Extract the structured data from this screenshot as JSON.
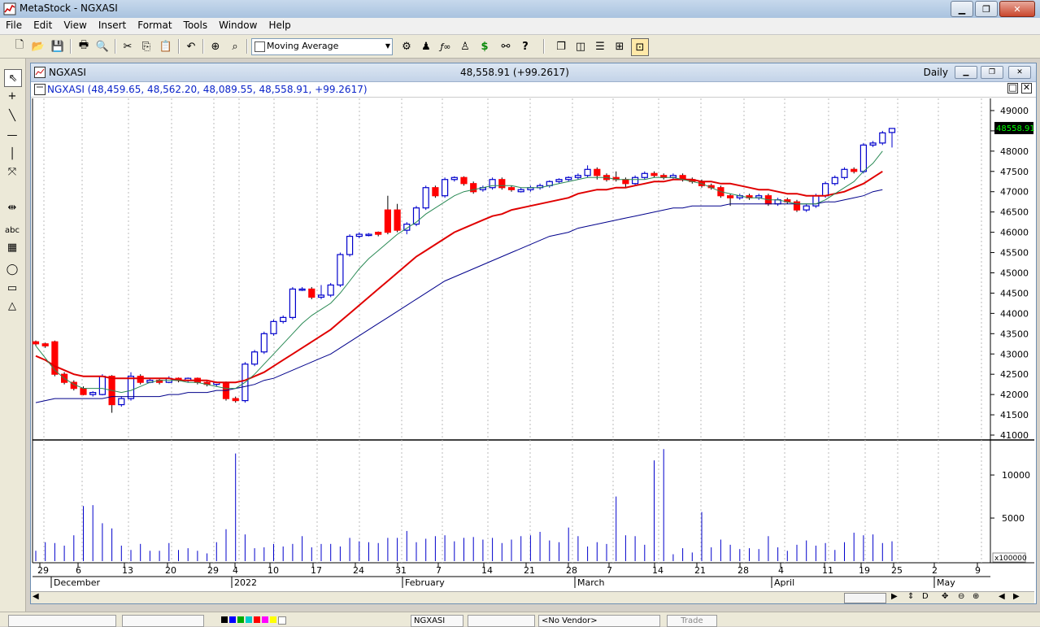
{
  "window": {
    "title": "MetaStock - NGXASI"
  },
  "menu": [
    "File",
    "Edit",
    "View",
    "Insert",
    "Format",
    "Tools",
    "Window",
    "Help"
  ],
  "toolbar": {
    "indicator_select": "Moving Average",
    "dollar": "$"
  },
  "chart_window": {
    "title": "NGXASI",
    "last_price": "48,558.91 (+99.2617)",
    "periodicity": "Daily",
    "security_info": "NGXASI (48,459.65, 48,562.20, 48,089.55, 48,558.91, +99.2617)",
    "price_tag": "48558.91",
    "volume_multiplier": "x100000"
  },
  "left_tools": {
    "abc_label": "abc"
  },
  "status": {
    "symbol": "NGXASI",
    "vendor": "<No Vendor>",
    "trade": "Trade"
  },
  "chart_data": {
    "type": "candlestick",
    "y_ticks": [
      "49000",
      "48500",
      "48000",
      "47500",
      "47000",
      "46500",
      "46000",
      "45500",
      "45000",
      "44500",
      "44000",
      "43500",
      "43000",
      "42500",
      "42000",
      "41500",
      "41000"
    ],
    "ylim": [
      40900,
      49300
    ],
    "volume_ticks": [
      "10000",
      "5000"
    ],
    "x_day_ticks": [
      "29",
      "6",
      "13",
      "20",
      "29",
      "4",
      "10",
      "17",
      "24",
      "31",
      "7",
      "14",
      "21",
      "28",
      "7",
      "14",
      "21",
      "28",
      "4",
      "11",
      "19",
      "25",
      "2",
      "9"
    ],
    "x_month_labels": [
      "December",
      "2022",
      "February",
      "March",
      "April",
      "May"
    ],
    "candles": [
      {
        "o": 43300,
        "c": 43250,
        "h": 43330,
        "l": 43200
      },
      {
        "o": 43250,
        "c": 43200,
        "h": 43280,
        "l": 43150
      },
      {
        "o": 43300,
        "c": 42500,
        "h": 43330,
        "l": 42450
      },
      {
        "o": 42500,
        "c": 42300,
        "h": 42550,
        "l": 42250
      },
      {
        "o": 42300,
        "c": 42150,
        "h": 42350,
        "l": 42100
      },
      {
        "o": 42150,
        "c": 42000,
        "h": 42200,
        "l": 41980
      },
      {
        "o": 42000,
        "c": 42050,
        "h": 42080,
        "l": 41950
      },
      {
        "o": 42000,
        "c": 42450,
        "h": 42500,
        "l": 41980
      },
      {
        "o": 42450,
        "c": 41750,
        "h": 42480,
        "l": 41550
      },
      {
        "o": 41750,
        "c": 41900,
        "h": 41950,
        "l": 41700
      },
      {
        "o": 41900,
        "c": 42450,
        "h": 42550,
        "l": 41850
      },
      {
        "o": 42450,
        "c": 42300,
        "h": 42500,
        "l": 42250
      },
      {
        "o": 42300,
        "c": 42350,
        "h": 42400,
        "l": 42280
      },
      {
        "o": 42350,
        "c": 42300,
        "h": 42400,
        "l": 42250
      },
      {
        "o": 42300,
        "c": 42400,
        "h": 42450,
        "l": 42280
      },
      {
        "o": 42400,
        "c": 42350,
        "h": 42420,
        "l": 42300
      },
      {
        "o": 42350,
        "c": 42400,
        "h": 42420,
        "l": 42300
      },
      {
        "o": 42400,
        "c": 42300,
        "h": 42420,
        "l": 42250
      },
      {
        "o": 42300,
        "c": 42250,
        "h": 42350,
        "l": 42200
      },
      {
        "o": 42250,
        "c": 42300,
        "h": 42320,
        "l": 42200
      },
      {
        "o": 42300,
        "c": 41900,
        "h": 42320,
        "l": 41850
      },
      {
        "o": 41900,
        "c": 41850,
        "h": 41950,
        "l": 41800
      },
      {
        "o": 41850,
        "c": 42750,
        "h": 42800,
        "l": 41800
      },
      {
        "o": 42750,
        "c": 43050,
        "h": 43100,
        "l": 42700
      },
      {
        "o": 43050,
        "c": 43500,
        "h": 43550,
        "l": 43000
      },
      {
        "o": 43500,
        "c": 43800,
        "h": 43850,
        "l": 43450
      },
      {
        "o": 43800,
        "c": 43900,
        "h": 43950,
        "l": 43750
      },
      {
        "o": 43900,
        "c": 44600,
        "h": 44650,
        "l": 43850
      },
      {
        "o": 44600,
        "c": 44600,
        "h": 44650,
        "l": 44550
      },
      {
        "o": 44600,
        "c": 44400,
        "h": 44650,
        "l": 44350
      },
      {
        "o": 44400,
        "c": 44450,
        "h": 44700,
        "l": 44350
      },
      {
        "o": 44450,
        "c": 44700,
        "h": 44750,
        "l": 44400
      },
      {
        "o": 44700,
        "c": 45450,
        "h": 45500,
        "l": 44650
      },
      {
        "o": 45450,
        "c": 45900,
        "h": 45950,
        "l": 45400
      },
      {
        "o": 45900,
        "c": 45950,
        "h": 46000,
        "l": 45850
      },
      {
        "o": 45950,
        "c": 45950,
        "h": 45980,
        "l": 45900
      },
      {
        "o": 46000,
        "c": 45950,
        "h": 46020,
        "l": 45900
      },
      {
        "o": 46550,
        "c": 46000,
        "h": 46900,
        "l": 45950
      },
      {
        "o": 46550,
        "c": 46050,
        "h": 46700,
        "l": 46000
      },
      {
        "o": 46050,
        "c": 46200,
        "h": 46250,
        "l": 45950
      },
      {
        "o": 46200,
        "c": 46600,
        "h": 46650,
        "l": 46150
      },
      {
        "o": 46600,
        "c": 47100,
        "h": 47150,
        "l": 46550
      },
      {
        "o": 47100,
        "c": 46900,
        "h": 47150,
        "l": 46850
      },
      {
        "o": 46900,
        "c": 47300,
        "h": 47350,
        "l": 46850
      },
      {
        "o": 47300,
        "c": 47350,
        "h": 47380,
        "l": 47250
      },
      {
        "o": 47350,
        "c": 47200,
        "h": 47380,
        "l": 47150
      },
      {
        "o": 47200,
        "c": 47000,
        "h": 47250,
        "l": 46950
      },
      {
        "o": 47050,
        "c": 47100,
        "h": 47150,
        "l": 47000
      },
      {
        "o": 47100,
        "c": 47300,
        "h": 47350,
        "l": 47050
      },
      {
        "o": 47300,
        "c": 47100,
        "h": 47350,
        "l": 47050
      },
      {
        "o": 47100,
        "c": 47050,
        "h": 47150,
        "l": 47000
      },
      {
        "o": 47000,
        "c": 47050,
        "h": 47100,
        "l": 46980
      },
      {
        "o": 47050,
        "c": 47100,
        "h": 47150,
        "l": 47000
      },
      {
        "o": 47100,
        "c": 47150,
        "h": 47200,
        "l": 47050
      },
      {
        "o": 47150,
        "c": 47250,
        "h": 47280,
        "l": 47100
      },
      {
        "o": 47250,
        "c": 47300,
        "h": 47330,
        "l": 47200
      },
      {
        "o": 47300,
        "c": 47350,
        "h": 47380,
        "l": 47250
      },
      {
        "o": 47350,
        "c": 47400,
        "h": 47450,
        "l": 47300
      },
      {
        "o": 47400,
        "c": 47550,
        "h": 47650,
        "l": 47350
      },
      {
        "o": 47550,
        "c": 47400,
        "h": 47600,
        "l": 47300
      },
      {
        "o": 47400,
        "c": 47300,
        "h": 47450,
        "l": 47250
      },
      {
        "o": 47350,
        "c": 47300,
        "h": 47500,
        "l": 47250
      },
      {
        "o": 47300,
        "c": 47200,
        "h": 47350,
        "l": 47100
      },
      {
        "o": 47200,
        "c": 47350,
        "h": 47400,
        "l": 47150
      },
      {
        "o": 47350,
        "c": 47450,
        "h": 47500,
        "l": 47300
      },
      {
        "o": 47450,
        "c": 47400,
        "h": 47500,
        "l": 47350
      },
      {
        "o": 47400,
        "c": 47350,
        "h": 47450,
        "l": 47300
      },
      {
        "o": 47350,
        "c": 47400,
        "h": 47450,
        "l": 47300
      },
      {
        "o": 47400,
        "c": 47300,
        "h": 47450,
        "l": 47250
      },
      {
        "o": 47300,
        "c": 47250,
        "h": 47350,
        "l": 47200
      },
      {
        "o": 47250,
        "c": 47150,
        "h": 47300,
        "l": 47100
      },
      {
        "o": 47150,
        "c": 47100,
        "h": 47200,
        "l": 47050
      },
      {
        "o": 47100,
        "c": 46900,
        "h": 47150,
        "l": 46850
      },
      {
        "o": 46900,
        "c": 46850,
        "h": 46950,
        "l": 46650
      },
      {
        "o": 46850,
        "c": 46900,
        "h": 46950,
        "l": 46800
      },
      {
        "o": 46900,
        "c": 46850,
        "h": 46950,
        "l": 46800
      },
      {
        "o": 46850,
        "c": 46900,
        "h": 46950,
        "l": 46800
      },
      {
        "o": 46900,
        "c": 46700,
        "h": 46950,
        "l": 46650
      },
      {
        "o": 46700,
        "c": 46800,
        "h": 46850,
        "l": 46650
      },
      {
        "o": 46800,
        "c": 46750,
        "h": 46850,
        "l": 46700
      },
      {
        "o": 46750,
        "c": 46550,
        "h": 46800,
        "l": 46500
      },
      {
        "o": 46550,
        "c": 46650,
        "h": 46700,
        "l": 46500
      },
      {
        "o": 46650,
        "c": 46900,
        "h": 46950,
        "l": 46600
      },
      {
        "o": 46900,
        "c": 47200,
        "h": 47250,
        "l": 46850
      },
      {
        "o": 47200,
        "c": 47350,
        "h": 47400,
        "l": 47150
      },
      {
        "o": 47350,
        "c": 47550,
        "h": 47600,
        "l": 47300
      },
      {
        "o": 47550,
        "c": 47500,
        "h": 47600,
        "l": 47450
      },
      {
        "o": 47500,
        "c": 48150,
        "h": 48200,
        "l": 47450
      },
      {
        "o": 48150,
        "c": 48200,
        "h": 48250,
        "l": 48100
      },
      {
        "o": 48200,
        "c": 48450,
        "h": 48500,
        "l": 48150
      },
      {
        "o": 48460,
        "c": 48559,
        "h": 48562,
        "l": 48090
      }
    ],
    "ma_fast": [
      43200,
      42900,
      42600,
      42400,
      42250,
      42150,
      42150,
      42150,
      42100,
      42050,
      42100,
      42200,
      42300,
      42350,
      42350,
      42350,
      42300,
      42300,
      42250,
      42200,
      42150,
      42150,
      42300,
      42500,
      42750,
      43000,
      43250,
      43500,
      43750,
      43950,
      44100,
      44250,
      44500,
      44800,
      45100,
      45350,
      45550,
      45750,
      45950,
      46100,
      46250,
      46450,
      46600,
      46750,
      46900,
      47000,
      47050,
      47100,
      47150,
      47150,
      47150,
      47100,
      47100,
      47100,
      47150,
      47200,
      47250,
      47300,
      47350,
      47350,
      47350,
      47300,
      47300,
      47300,
      47300,
      47350,
      47350,
      47350,
      47300,
      47250,
      47200,
      47100,
      47000,
      46950,
      46900,
      46850,
      46850,
      46800,
      46800,
      46750,
      46700,
      46700,
      46700,
      46800,
      46950,
      47100,
      47250,
      47500,
      47700,
      48000
    ],
    "ma_mid": [
      42950,
      42850,
      42700,
      42600,
      42500,
      42450,
      42450,
      42450,
      42400,
      42400,
      42400,
      42400,
      42400,
      42400,
      42400,
      42350,
      42350,
      42350,
      42350,
      42300,
      42300,
      42300,
      42350,
      42450,
      42550,
      42700,
      42850,
      43000,
      43150,
      43300,
      43450,
      43600,
      43800,
      44000,
      44200,
      44400,
      44600,
      44800,
      45000,
      45200,
      45400,
      45550,
      45700,
      45850,
      46000,
      46100,
      46200,
      46300,
      46400,
      46450,
      46550,
      46600,
      46650,
      46700,
      46750,
      46800,
      46850,
      46950,
      47000,
      47050,
      47050,
      47100,
      47100,
      47150,
      47200,
      47250,
      47250,
      47300,
      47300,
      47300,
      47250,
      47250,
      47200,
      47200,
      47150,
      47100,
      47050,
      47050,
      47000,
      46950,
      46950,
      46900,
      46900,
      46900,
      46950,
      47000,
      47100,
      47200,
      47350,
      47500
    ],
    "ma_slow": [
      41800,
      41850,
      41900,
      41900,
      41900,
      41900,
      41900,
      41900,
      41950,
      41950,
      41950,
      41950,
      41950,
      41950,
      42000,
      42000,
      42050,
      42050,
      42050,
      42100,
      42100,
      42150,
      42200,
      42250,
      42350,
      42400,
      42500,
      42600,
      42700,
      42800,
      42900,
      43000,
      43150,
      43300,
      43450,
      43600,
      43750,
      43900,
      44050,
      44200,
      44350,
      44500,
      44650,
      44800,
      44900,
      45000,
      45100,
      45200,
      45300,
      45400,
      45500,
      45600,
      45700,
      45800,
      45900,
      45950,
      46000,
      46100,
      46150,
      46200,
      46250,
      46300,
      46350,
      46400,
      46450,
      46500,
      46550,
      46600,
      46600,
      46650,
      46650,
      46650,
      46650,
      46700,
      46700,
      46700,
      46700,
      46700,
      46700,
      46700,
      46700,
      46700,
      46700,
      46750,
      46750,
      46800,
      46850,
      46900,
      47000,
      47050
    ]
  }
}
